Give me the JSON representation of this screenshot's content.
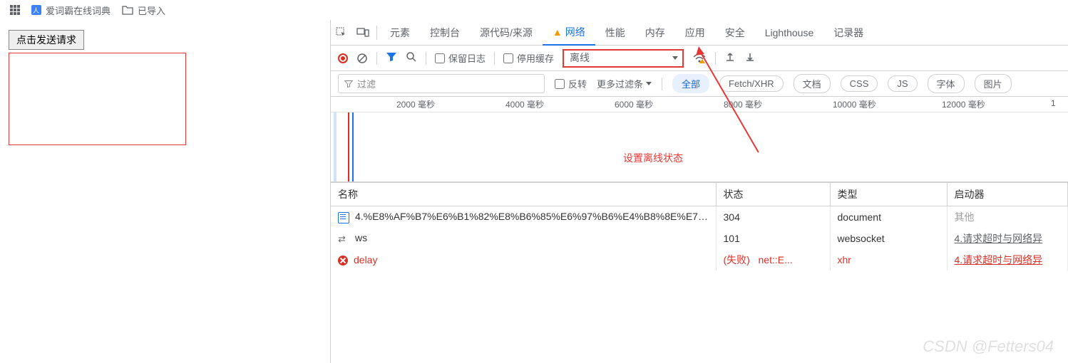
{
  "bookmarks": {
    "dict_label": "爱词霸在线词典",
    "imported_label": "已导入"
  },
  "page": {
    "button_label": "点击发送请求"
  },
  "devtools": {
    "tabs": [
      "元素",
      "控制台",
      "源代码/来源",
      "网络",
      "性能",
      "内存",
      "应用",
      "安全",
      "Lighthouse",
      "记录器"
    ],
    "active_tab": "网络",
    "toolbar": {
      "preserve_log": "保留日志",
      "disable_cache": "停用缓存",
      "throttle_value": "离线"
    },
    "filter": {
      "placeholder": "过滤",
      "invert": "反转",
      "more_filters": "更多过滤条",
      "types": [
        "全部",
        "Fetch/XHR",
        "文档",
        "CSS",
        "JS",
        "字体",
        "图片"
      ],
      "active_type": "全部"
    },
    "timeline": {
      "ticks": [
        "2000 毫秒",
        "4000 毫秒",
        "6000 毫秒",
        "8000 毫秒",
        "10000 毫秒",
        "12000 毫秒",
        "1"
      ]
    },
    "columns": {
      "name": "名称",
      "status": "状态",
      "type": "类型",
      "initiator": "启动器"
    },
    "requests": [
      {
        "icon": "document",
        "name": "4.%E8%AF%B7%E6%B1%82%E8%B6%85%E6%97%B6%E4%B8%8E%E7%BD%91%E7%BB%9C%E5%BC%82...",
        "status": "304",
        "status_extra": "",
        "type": "document",
        "initiator": "其他",
        "initiator_class": "gray",
        "failed": false
      },
      {
        "icon": "websocket",
        "name": "ws",
        "status": "101",
        "status_extra": "",
        "type": "websocket",
        "initiator": "4.请求超时与网络异",
        "initiator_class": "link",
        "failed": false
      },
      {
        "icon": "error",
        "name": "delay",
        "status": "(失败)",
        "status_extra": "net::E...",
        "type": "xhr",
        "initiator": "4.请求超时与网络异",
        "initiator_class": "link-err",
        "failed": true
      }
    ]
  },
  "annotation": "设置离线状态",
  "watermark": "CSDN @Fetters04"
}
